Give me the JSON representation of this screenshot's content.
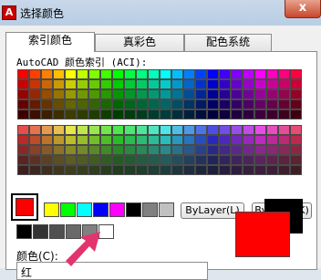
{
  "window": {
    "title": "选择颜色",
    "close_glyph": "x"
  },
  "tabs": [
    {
      "label": "索引颜色",
      "active": true
    },
    {
      "label": "真彩色",
      "active": false
    },
    {
      "label": "配色系统",
      "active": false
    }
  ],
  "aci_label": "AutoCAD 颜色索引 (ACI):",
  "standard_colors": [
    "#ffff00",
    "#00ff00",
    "#00ffff",
    "#0000ff",
    "#ff00ff",
    "#000000",
    "#808080",
    "#c0c0c0"
  ],
  "gray_colors": [
    "#000000",
    "#333333",
    "#505050",
    "#696969",
    "#808080",
    "#ffffff"
  ],
  "selected_color": "#ff0000",
  "buttons": {
    "bylayer": "ByLayer(L)",
    "byblock": "ByBlock(K)"
  },
  "color_field": {
    "label": "颜色(C):",
    "value": "红"
  },
  "accent_arrow_color": "#e2346d",
  "icons": {
    "app": "autocad-logo-icon",
    "close": "close-icon"
  }
}
